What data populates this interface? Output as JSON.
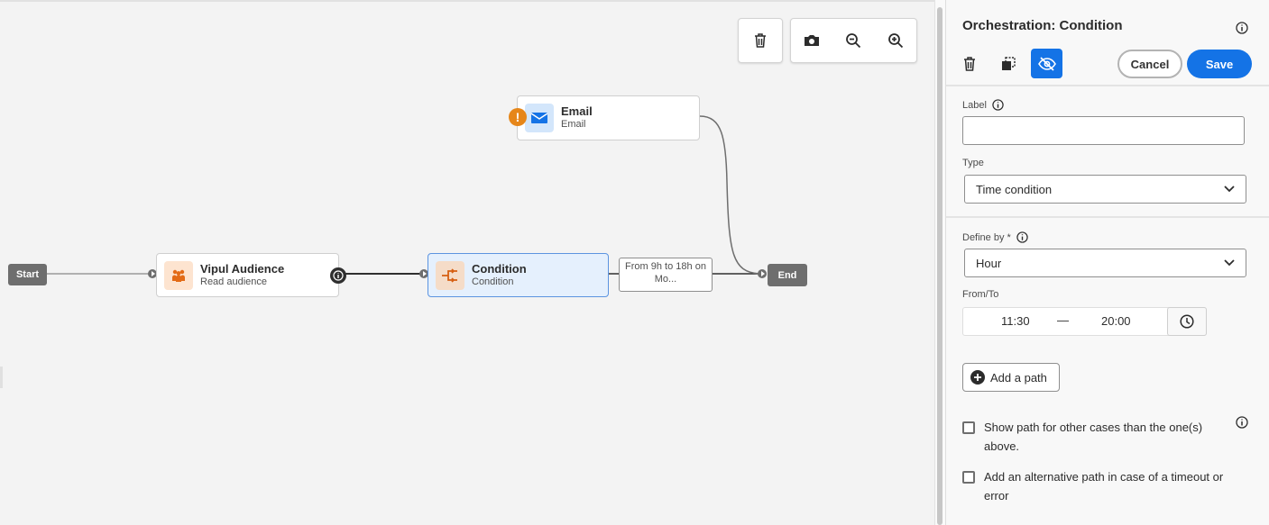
{
  "canvas": {
    "toolbar": {
      "delete_icon": "trash-icon",
      "screenshot_icon": "camera-icon",
      "zoom_out_icon": "zoom-out-icon",
      "zoom_in_icon": "zoom-in-icon"
    },
    "nodes": {
      "start": {
        "label": "Start"
      },
      "end": {
        "label": "End"
      },
      "audience": {
        "title": "Vipul Audience",
        "subtitle": "Read audience",
        "icon": "audience-icon"
      },
      "condition": {
        "title": "Condition",
        "subtitle": "Condition",
        "icon": "condition-icon"
      },
      "email": {
        "title": "Email",
        "subtitle": "Email",
        "icon": "envelope-icon",
        "warning": "!"
      }
    },
    "transition_label": {
      "line1": "From 9h  to 18h  on",
      "line2": "Mo..."
    }
  },
  "panel": {
    "title": "Orchestration: Condition",
    "cancel_label": "Cancel",
    "save_label": "Save",
    "label_field": {
      "label": "Label",
      "value": ""
    },
    "type_field": {
      "label": "Type",
      "value": "Time condition"
    },
    "define_by": {
      "label": "Define by",
      "required_mark": "*",
      "value": "Hour"
    },
    "from_to": {
      "label": "From/To",
      "from": "11:30",
      "separator": "—",
      "to": "20:00"
    },
    "add_path_label": "Add a path",
    "checkbox_other": {
      "line1": "Show path for other cases than the one(s)",
      "line2": "above.",
      "checked": false
    },
    "checkbox_alt": {
      "line1": "Add an alternative path in case of a timeout or",
      "line2": "error",
      "checked": false
    }
  },
  "colors": {
    "accent": "#1473e6",
    "selected_node_bg": "#e5f0fd",
    "audience_icon_bg": "#fde4d0",
    "warning": "#e68619"
  }
}
